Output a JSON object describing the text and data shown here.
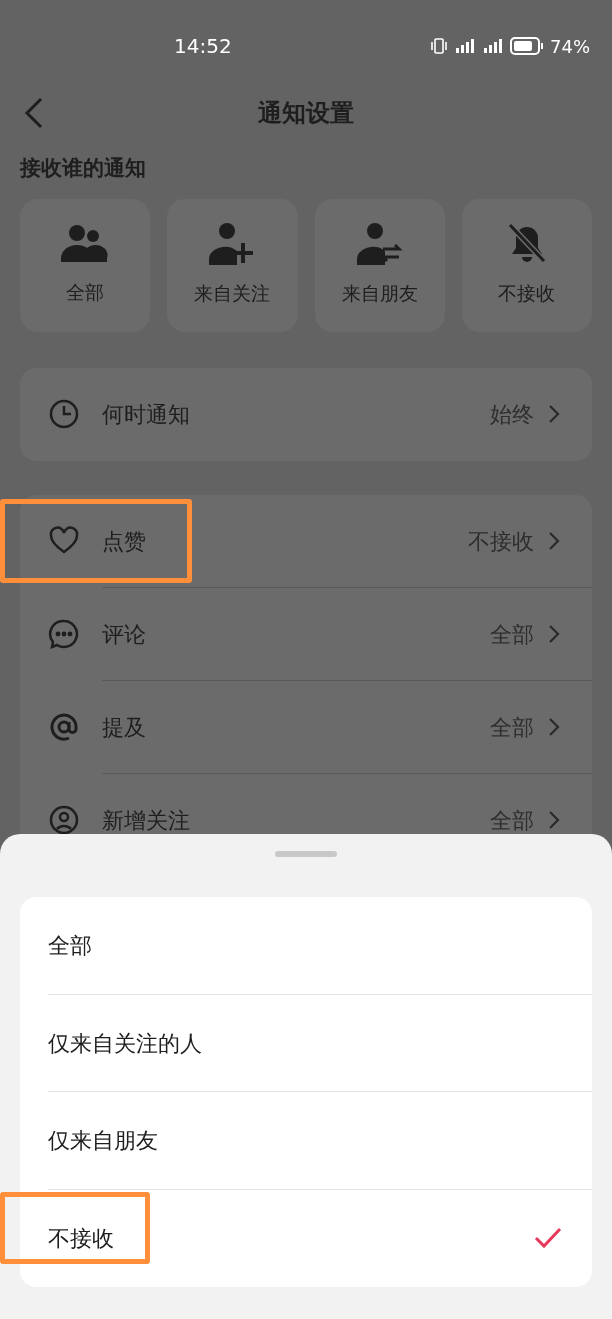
{
  "status_bar": {
    "time": "14:52",
    "battery": "74%"
  },
  "header": {
    "title": "通知设置"
  },
  "audience": {
    "title": "接收谁的通知",
    "options": [
      {
        "kind": "all",
        "label": "全部"
      },
      {
        "kind": "following",
        "label": "来自关注"
      },
      {
        "kind": "friends",
        "label": "来自朋友"
      },
      {
        "kind": "none",
        "label": "不接收"
      }
    ]
  },
  "when_row": {
    "kind": "clock",
    "label": "何时通知",
    "value": "始终"
  },
  "settings": [
    {
      "kind": "heart",
      "label": "点赞",
      "value": "不接收",
      "highlighted": true
    },
    {
      "kind": "comment",
      "label": "评论",
      "value": "全部",
      "highlighted": false
    },
    {
      "kind": "at",
      "label": "提及",
      "value": "全部",
      "highlighted": false
    },
    {
      "kind": "person",
      "label": "新增关注",
      "value": "全部",
      "highlighted": false
    }
  ],
  "sheet": {
    "options": [
      {
        "label": "全部",
        "selected": false,
        "highlighted": false
      },
      {
        "label": "仅来自关注的人",
        "selected": false,
        "highlighted": false
      },
      {
        "label": "仅来自朋友",
        "selected": false,
        "highlighted": false
      },
      {
        "label": "不接收",
        "selected": true,
        "highlighted": true
      }
    ]
  }
}
